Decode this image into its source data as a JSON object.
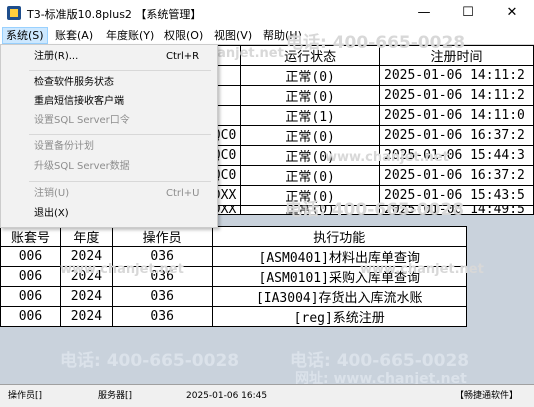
{
  "window": {
    "title": "T3-标准版10.8plus2 【系统管理】",
    "minimize": "—",
    "maximize": "☐",
    "close": "✕"
  },
  "menubar": [
    "系统(S)",
    "账套(A)",
    "年度账(Y)",
    "权限(O)",
    "视图(V)",
    "帮助(H)"
  ],
  "system_menu": [
    {
      "label": "注册(R)...",
      "shortcut": "Ctrl+R",
      "disabled": false
    },
    {
      "label": "检查软件服务状态",
      "shortcut": "",
      "disabled": false
    },
    {
      "label": "重启短信接收客户端",
      "shortcut": "",
      "disabled": false
    },
    {
      "label": "设置SQL Server口令",
      "shortcut": "",
      "disabled": true
    },
    {
      "label": "设置备份计划",
      "shortcut": "",
      "disabled": true
    },
    {
      "label": "升级SQL Server数据",
      "shortcut": "",
      "disabled": true
    },
    {
      "label": "注销(U)",
      "shortcut": "Ctrl+U",
      "disabled": true
    },
    {
      "label": "退出(X)",
      "shortcut": "",
      "disabled": false
    }
  ],
  "task_table": {
    "headers": [
      "运行状态",
      "注册时间"
    ],
    "rows": [
      {
        "code": "",
        "status": "正常(0)",
        "time": "2025-01-06 14:11:2"
      },
      {
        "code": "",
        "status": "正常(0)",
        "time": "2025-01-06 14:11:2"
      },
      {
        "code": "",
        "status": "正常(1)",
        "time": "2025-01-06 14:11:0"
      },
      {
        "code": "QC0",
        "status": "正常(0)",
        "time": "2025-01-06 16:37:2"
      },
      {
        "code": "QC0",
        "status": "正常(0)",
        "time": "2025-01-06 15:44:3"
      },
      {
        "code": "QC0",
        "status": "正常(0)",
        "time": "2025-01-06 16:37:2"
      },
      {
        "code": "DXX",
        "status": "正常(0)",
        "time": "2025-01-06 15:43:5"
      },
      {
        "code": "DXX",
        "status": "正常(0)",
        "time": "2025-01-06 14:49:5"
      }
    ]
  },
  "log_table": {
    "headers": [
      "账套号",
      "年度",
      "操作员",
      "执行功能"
    ],
    "rows": [
      {
        "acct": "006",
        "year": "2024",
        "op": "036",
        "func": "[ASM0401]材料出库单查询"
      },
      {
        "acct": "006",
        "year": "2024",
        "op": "036",
        "func": "[ASM0101]采购入库单查询"
      },
      {
        "acct": "006",
        "year": "2024",
        "op": "036",
        "func": "[IA3004]存货出入库流水账"
      },
      {
        "acct": "006",
        "year": "2024",
        "op": "036",
        "func": "[reg]系统注册"
      }
    ]
  },
  "watermarks": [
    "电话: 400-665-0028",
    "www.chanjet.net",
    "网址: www.chanjet.net"
  ],
  "statusbar": {
    "operator": "操作员[]",
    "server": "服务器[]",
    "datetime": "2025-01-06 16:45",
    "brand": "【畅捷通软件】"
  }
}
